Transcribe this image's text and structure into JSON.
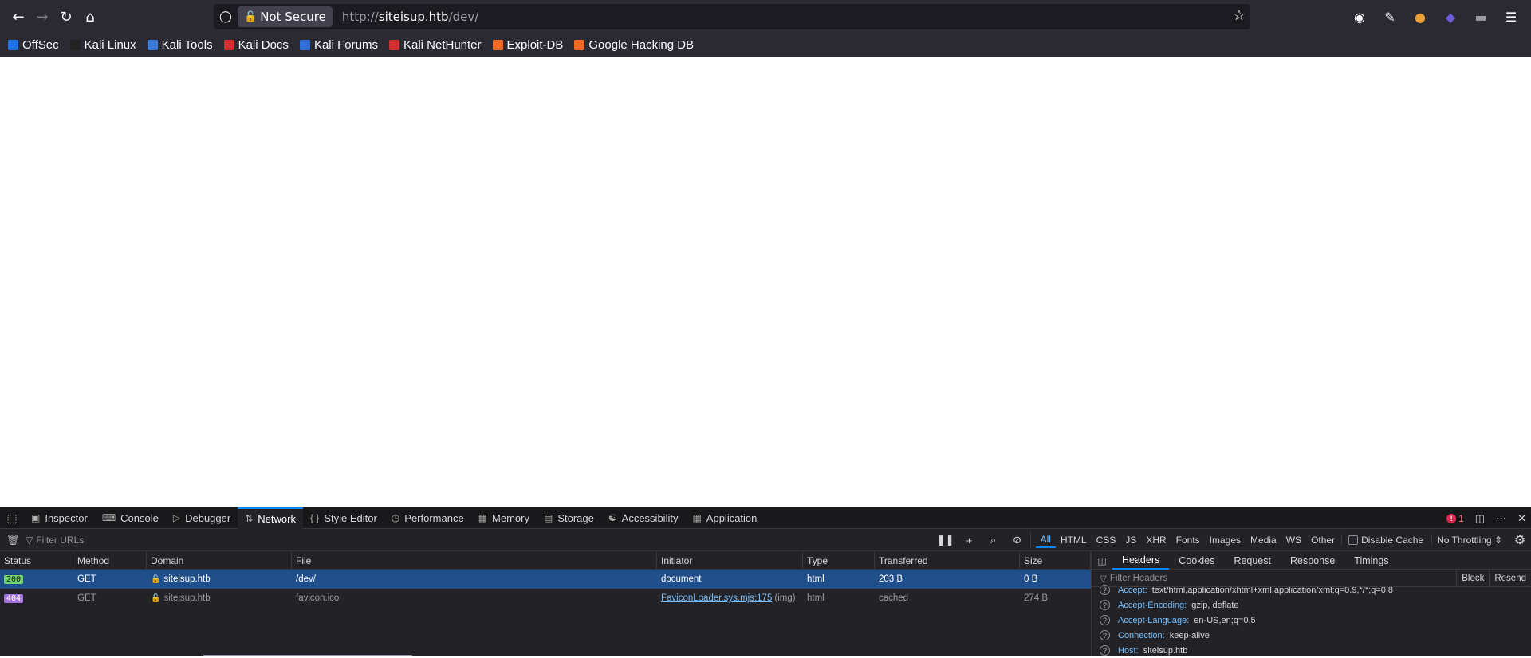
{
  "toolbar": {
    "not_secure_label": "Not Secure",
    "url_prefix": "http://",
    "url_host": "siteisup.htb",
    "url_path": "/dev/"
  },
  "bookmarks": [
    {
      "label": "OffSec",
      "color": "#1a73e8"
    },
    {
      "label": "Kali Linux",
      "color": "#222222"
    },
    {
      "label": "Kali Tools",
      "color": "#3b7bd9"
    },
    {
      "label": "Kali Docs",
      "color": "#d32f2f"
    },
    {
      "label": "Kali Forums",
      "color": "#2f6fd9"
    },
    {
      "label": "Kali NetHunter",
      "color": "#d32f2f"
    },
    {
      "label": "Exploit-DB",
      "color": "#f06a24"
    },
    {
      "label": "Google Hacking DB",
      "color": "#f06a24"
    }
  ],
  "devtools": {
    "tabs": [
      "Inspector",
      "Console",
      "Debugger",
      "Network",
      "Style Editor",
      "Performance",
      "Memory",
      "Storage",
      "Accessibility",
      "Application"
    ],
    "active_tab": "Network",
    "error_count": "1",
    "filter_placeholder": "Filter URLs",
    "type_filters": [
      "All",
      "HTML",
      "CSS",
      "JS",
      "XHR",
      "Fonts",
      "Images",
      "Media",
      "WS",
      "Other"
    ],
    "disable_cache_label": "Disable Cache",
    "throttling_label": "No Throttling ⇕",
    "columns": [
      "Status",
      "Method",
      "Domain",
      "File",
      "Initiator",
      "Type",
      "Transferred",
      "Size"
    ],
    "requests": [
      {
        "status": "200",
        "method": "GET",
        "domain": "siteisup.htb",
        "file": "/dev/",
        "initiator": "document",
        "initiator_suffix": "",
        "type": "html",
        "transferred": "203 B",
        "size": "0 B"
      },
      {
        "status": "404",
        "method": "GET",
        "domain": "siteisup.htb",
        "file": "favicon.ico",
        "initiator": "FaviconLoader.sys.mjs:175",
        "initiator_suffix": "(img)",
        "type": "html",
        "transferred": "cached",
        "size": "274 B"
      }
    ],
    "side_tabs": [
      "Headers",
      "Cookies",
      "Request",
      "Response",
      "Timings"
    ],
    "side_filter_placeholder": "Filter Headers",
    "side_actions": [
      "Block",
      "Resend"
    ],
    "headers": [
      {
        "name": "Accept:",
        "value": "text/html,application/xhtml+xml,application/xml;q=0.9,*/*;q=0.8"
      },
      {
        "name": "Accept-Encoding:",
        "value": "gzip, deflate"
      },
      {
        "name": "Accept-Language:",
        "value": "en-US,en;q=0.5"
      },
      {
        "name": "Connection:",
        "value": "keep-alive"
      },
      {
        "name": "Host:",
        "value": "siteisup.htb"
      }
    ]
  }
}
